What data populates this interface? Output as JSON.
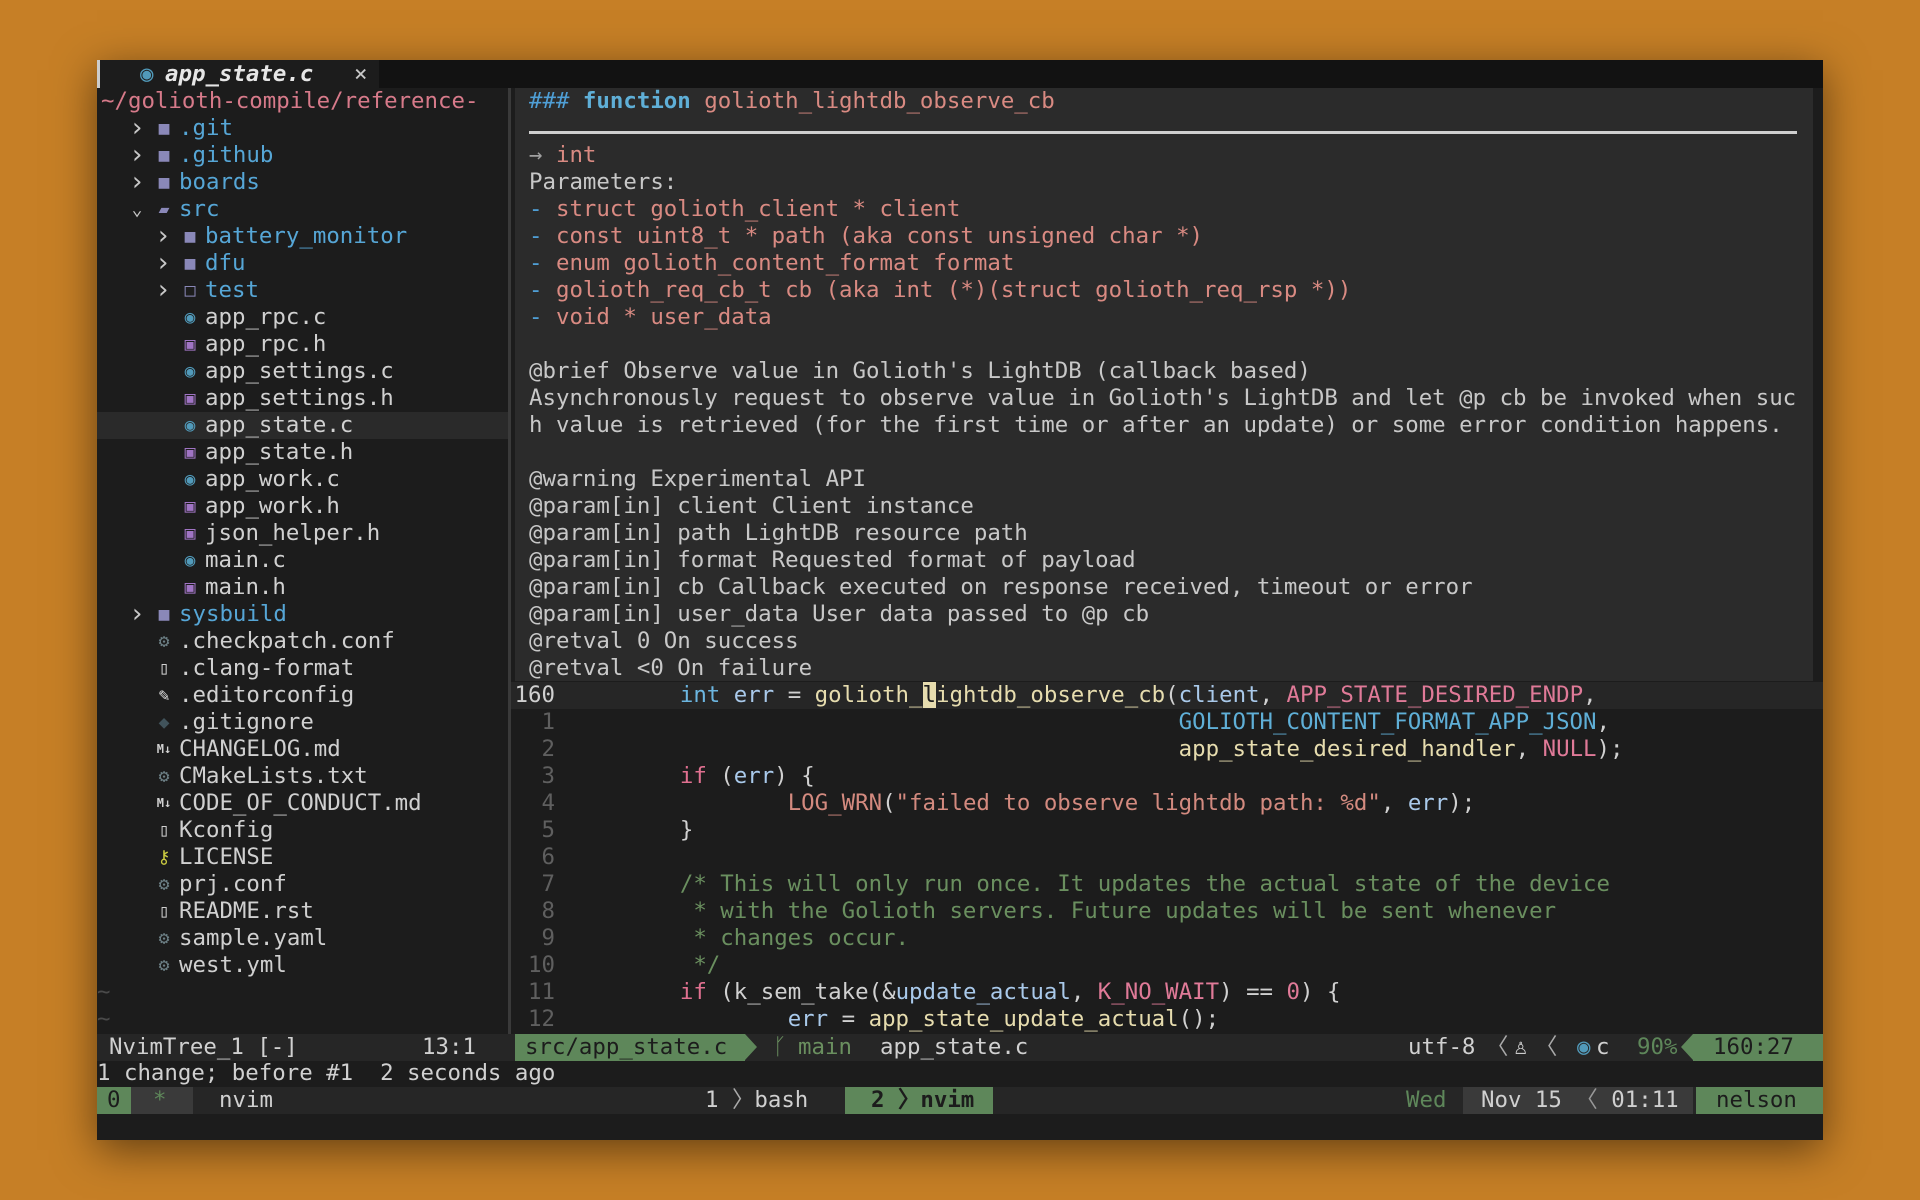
{
  "palette": {
    "hash": "#4f9fd6",
    "kw": "#5fafd7",
    "name": "#d98a82",
    "text": "#c8c8c8",
    "param": "#d98a82",
    "dim": "#a0a0a0",
    "type": "#6cb6e0",
    "var": "#a9c9ea",
    "op": "#d0d0d0",
    "fn": "#e6dcae",
    "const": "#e07a98",
    "macro": "#5fafd7",
    "pink": "#e07090",
    "str": "#d38a7f",
    "comment": "#6a8f5f",
    "num": "#e07a98",
    "cursor": "#1c1c1c"
  },
  "tab": {
    "icon": "c-file-icon",
    "label": "app_state.c",
    "close": "×"
  },
  "tree": {
    "root": "~/golioth-compile/reference-",
    "items": [
      {
        "d": 0,
        "chev": "›",
        "icon": "folder",
        "label": ".git",
        "c": "#56a6d6"
      },
      {
        "d": 0,
        "chev": "›",
        "icon": "folder",
        "label": ".github",
        "c": "#56a6d6"
      },
      {
        "d": 0,
        "chev": "›",
        "icon": "folder",
        "label": "boards",
        "c": "#56a6d6"
      },
      {
        "d": 0,
        "chev": "⌄",
        "icon": "folder-open",
        "label": "src",
        "c": "#56a6d6"
      },
      {
        "d": 1,
        "chev": "›",
        "icon": "folder",
        "label": "battery_monitor",
        "c": "#56a6d6"
      },
      {
        "d": 1,
        "chev": "›",
        "icon": "folder",
        "label": "dfu",
        "c": "#56a6d6"
      },
      {
        "d": 1,
        "chev": "›",
        "icon": "folder-empty",
        "label": "test",
        "c": "#56a6d6"
      },
      {
        "d": 1,
        "chev": "",
        "icon": "c",
        "label": "app_rpc.c",
        "c": "#d0d0d0"
      },
      {
        "d": 1,
        "chev": "",
        "icon": "h",
        "label": "app_rpc.h",
        "c": "#d0d0d0"
      },
      {
        "d": 1,
        "chev": "",
        "icon": "c",
        "label": "app_settings.c",
        "c": "#d0d0d0"
      },
      {
        "d": 1,
        "chev": "",
        "icon": "h",
        "label": "app_settings.h",
        "c": "#d0d0d0"
      },
      {
        "d": 1,
        "chev": "",
        "icon": "c",
        "label": "app_state.c",
        "c": "#d0d0d0",
        "sel": true
      },
      {
        "d": 1,
        "chev": "",
        "icon": "h",
        "label": "app_state.h",
        "c": "#d0d0d0"
      },
      {
        "d": 1,
        "chev": "",
        "icon": "c",
        "label": "app_work.c",
        "c": "#d0d0d0"
      },
      {
        "d": 1,
        "chev": "",
        "icon": "h",
        "label": "app_work.h",
        "c": "#d0d0d0"
      },
      {
        "d": 1,
        "chev": "",
        "icon": "h",
        "label": "json_helper.h",
        "c": "#d0d0d0"
      },
      {
        "d": 1,
        "chev": "",
        "icon": "c",
        "label": "main.c",
        "c": "#d0d0d0"
      },
      {
        "d": 1,
        "chev": "",
        "icon": "h",
        "label": "main.h",
        "c": "#d0d0d0"
      },
      {
        "d": 0,
        "chev": "›",
        "icon": "folder",
        "label": "sysbuild",
        "c": "#56a6d6"
      },
      {
        "d": 0,
        "chev": "",
        "icon": "gear",
        "label": ".checkpatch.conf",
        "c": "#d0d0d0"
      },
      {
        "d": 0,
        "chev": "",
        "icon": "file",
        "label": ".clang-format",
        "c": "#d0d0d0"
      },
      {
        "d": 0,
        "chev": "",
        "icon": "brush",
        "label": ".editorconfig",
        "c": "#d0d0d0"
      },
      {
        "d": 0,
        "chev": "",
        "icon": "git",
        "label": ".gitignore",
        "c": "#d0d0d0"
      },
      {
        "d": 0,
        "chev": "",
        "icon": "markdown",
        "label": "CHANGELOG.md",
        "c": "#d0d0d0"
      },
      {
        "d": 0,
        "chev": "",
        "icon": "gear",
        "label": "CMakeLists.txt",
        "c": "#d0d0d0"
      },
      {
        "d": 0,
        "chev": "",
        "icon": "markdown",
        "label": "CODE_OF_CONDUCT.md",
        "c": "#d0d0d0"
      },
      {
        "d": 0,
        "chev": "",
        "icon": "file",
        "label": "Kconfig",
        "c": "#d0d0d0"
      },
      {
        "d": 0,
        "chev": "",
        "icon": "key",
        "label": "LICENSE",
        "c": "#d0d0d0"
      },
      {
        "d": 0,
        "chev": "",
        "icon": "gear",
        "label": "prj.conf",
        "c": "#d0d0d0"
      },
      {
        "d": 0,
        "chev": "",
        "icon": "file",
        "label": "README.rst",
        "c": "#d0d0d0"
      },
      {
        "d": 0,
        "chev": "",
        "icon": "gear",
        "label": "sample.yaml",
        "c": "#d0d0d0"
      },
      {
        "d": 0,
        "chev": "",
        "icon": "gear",
        "label": "west.yml",
        "c": "#d0d0d0"
      }
    ],
    "tildes": [
      "~",
      "~"
    ]
  },
  "doc": {
    "header": [
      [
        "### ",
        "hash"
      ],
      [
        "function ",
        "kw"
      ],
      [
        "golioth_lightdb_observe_cb",
        "name"
      ]
    ],
    "lines": [
      [
        [
          "→ ",
          "dim"
        ],
        [
          "int",
          "param"
        ]
      ],
      [
        [
          "Parameters:",
          "text"
        ]
      ],
      [
        [
          "- ",
          "hash"
        ],
        [
          "struct golioth_client * client",
          "param"
        ]
      ],
      [
        [
          "- ",
          "hash"
        ],
        [
          "const uint8_t * path (aka const unsigned char *)",
          "param"
        ]
      ],
      [
        [
          "- ",
          "hash"
        ],
        [
          "enum golioth_content_format format",
          "param"
        ]
      ],
      [
        [
          "- ",
          "hash"
        ],
        [
          "golioth_req_cb_t cb (aka int (*)(struct golioth_req_rsp *))",
          "param"
        ]
      ],
      [
        [
          "- ",
          "hash"
        ],
        [
          "void * user_data",
          "param"
        ]
      ],
      [],
      [
        [
          "@brief Observe value in Golioth's LightDB (callback based)",
          "text"
        ]
      ],
      [
        [
          "Asynchronously request to observe value in Golioth's LightDB and let @p cb be invoked when suc",
          "text"
        ]
      ],
      [
        [
          "h value is retrieved (for the first time or after an update) or some error condition happens.",
          "text"
        ]
      ],
      [],
      [
        [
          "@warning Experimental API",
          "text"
        ]
      ],
      [
        [
          "@param[in] client Client instance",
          "text"
        ]
      ],
      [
        [
          "@param[in] path LightDB resource path",
          "text"
        ]
      ],
      [
        [
          "@param[in] format Requested format of payload",
          "text"
        ]
      ],
      [
        [
          "@param[in] cb Callback executed on response received, timeout or error",
          "text"
        ]
      ],
      [
        [
          "@param[in] user_data User data passed to @p cb",
          "text"
        ]
      ],
      [
        [
          "@retval 0 On success",
          "text"
        ]
      ],
      [
        [
          "@retval <0 On failure",
          "text"
        ]
      ]
    ]
  },
  "code": {
    "lines": [
      {
        "n": "160",
        "cur": true,
        "tokens": [
          [
            "        ",
            "op"
          ],
          [
            "int",
            "type"
          ],
          [
            " err",
            "var"
          ],
          [
            " = ",
            "op"
          ],
          [
            "golioth_",
            "fn"
          ],
          [
            "l",
            "cursor"
          ],
          [
            "ightdb_observe_cb",
            "fn"
          ],
          [
            "(",
            "op"
          ],
          [
            "client",
            "var"
          ],
          [
            ", ",
            "op"
          ],
          [
            "APP_STATE_DESIRED_ENDP",
            "const"
          ],
          [
            ",",
            "op"
          ]
        ]
      },
      {
        "n": "1",
        "tokens": [
          [
            "                                             ",
            "op"
          ],
          [
            "GOLIOTH_CONTENT_FORMAT_APP_JSON",
            "macro"
          ],
          [
            ",",
            "op"
          ]
        ]
      },
      {
        "n": "2",
        "tokens": [
          [
            "                                             ",
            "op"
          ],
          [
            "app_state_desired_handler",
            "fn"
          ],
          [
            ", ",
            "op"
          ],
          [
            "NULL",
            "const"
          ],
          [
            ");",
            "op"
          ]
        ]
      },
      {
        "n": "3",
        "tokens": [
          [
            "        ",
            "op"
          ],
          [
            "if",
            "pink"
          ],
          [
            " (",
            "op"
          ],
          [
            "err",
            "var"
          ],
          [
            ") {",
            "op"
          ]
        ]
      },
      {
        "n": "4",
        "tokens": [
          [
            "                ",
            "op"
          ],
          [
            "LOG_WRN",
            "str"
          ],
          [
            "(",
            "op"
          ],
          [
            "\"failed to observe lightdb path: %d\"",
            "str"
          ],
          [
            ", ",
            "op"
          ],
          [
            "err",
            "var"
          ],
          [
            ");",
            "op"
          ]
        ]
      },
      {
        "n": "5",
        "tokens": [
          [
            "        }",
            "op"
          ]
        ]
      },
      {
        "n": "6",
        "tokens": []
      },
      {
        "n": "7",
        "tokens": [
          [
            "        /* This will only run once. It updates the actual state of the device",
            "comment"
          ]
        ]
      },
      {
        "n": "8",
        "tokens": [
          [
            "         * with the Golioth servers. Future updates will be sent whenever",
            "comment"
          ]
        ]
      },
      {
        "n": "9",
        "tokens": [
          [
            "         * changes occur.",
            "comment"
          ]
        ]
      },
      {
        "n": "10",
        "tokens": [
          [
            "         */",
            "comment"
          ]
        ]
      },
      {
        "n": "11",
        "tokens": [
          [
            "        ",
            "op"
          ],
          [
            "if",
            "pink"
          ],
          [
            " (",
            "op"
          ],
          [
            "k_sem_take",
            "op"
          ],
          [
            "(&",
            "op"
          ],
          [
            "update_actual",
            "var"
          ],
          [
            ", ",
            "op"
          ],
          [
            "K_NO_WAIT",
            "const"
          ],
          [
            ") == ",
            "op"
          ],
          [
            "0",
            "num"
          ],
          [
            ") {",
            "op"
          ]
        ]
      },
      {
        "n": "12",
        "tokens": [
          [
            "                ",
            "op"
          ],
          [
            "err",
            "var"
          ],
          [
            " = ",
            "op"
          ],
          [
            "app_state_update_actual",
            "fn"
          ],
          [
            "();",
            "op"
          ]
        ]
      }
    ]
  },
  "statusline": {
    "tree_name": "NvimTree_1 [-]",
    "tree_pos": "13:1",
    "path": "src/app_state.c",
    "branch_icon": "git-branch-icon",
    "branch": "main",
    "filename": "app_state.c",
    "encoding": "utf-8",
    "os_icon": "linux-icon",
    "ft_icon": "c-file-icon",
    "filetype": "c",
    "percent": "90%",
    "position": "160:27"
  },
  "message": "1 change; before #1  2 seconds ago",
  "tmux": {
    "session": "0",
    "flag": "*",
    "current": "nvim",
    "win1_index": "1",
    "win1_name": "bash",
    "win2_index": "2",
    "win2_name": "nvim",
    "day": "Wed",
    "date": "Nov 15",
    "time": "01:11",
    "user": "nelson"
  }
}
